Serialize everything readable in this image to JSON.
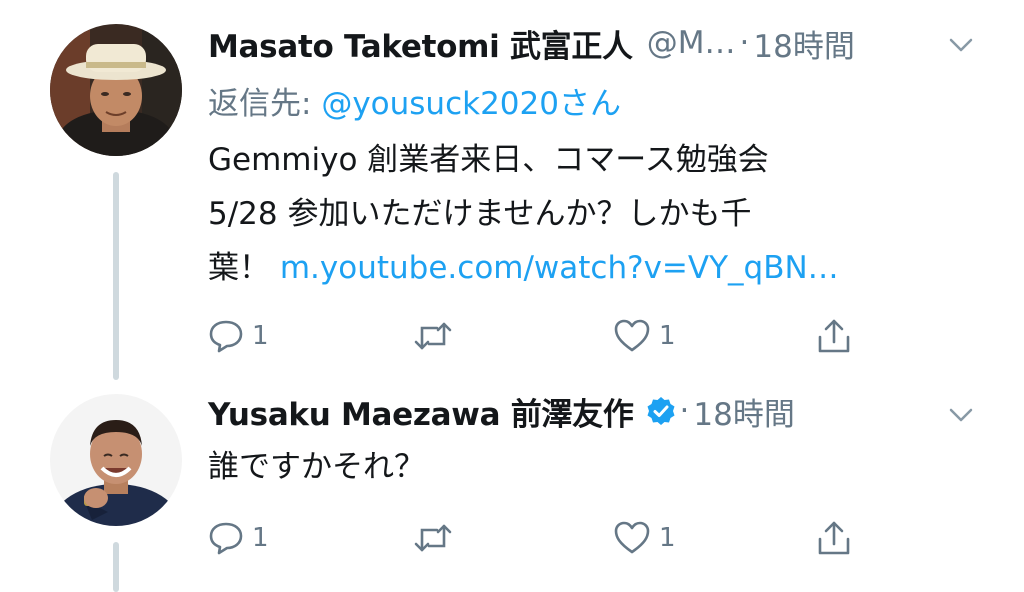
{
  "colors": {
    "text_primary": "#14171a",
    "text_secondary": "#657786",
    "link": "#1da1f2",
    "verified": "#1da1f2",
    "thread_line": "#cfd9de"
  },
  "tweets": [
    {
      "display_name": "Masato Taketomi 武富正人",
      "handle": "@M…",
      "separator": "·",
      "time": "18時間",
      "reply_to_prefix": "返信先:",
      "reply_to_mention": "@yousuck2020さん",
      "body_line1": "Gemmiyo 創業者来日、コマース勉強会",
      "body_line2": "5/28 参加いただけませんか？しかも千",
      "body_line3_text": "葉！",
      "body_line3_link": "m.youtube.com/watch?v=VY_qBN…",
      "verified": false,
      "reply_count": "1",
      "like_count": "1",
      "avatar_icon": "avatar-man-with-hat"
    },
    {
      "display_name": "Yusaku Maezawa 前澤友作",
      "separator": "·",
      "time": "18時間",
      "body_line1": "誰ですかそれ？",
      "verified": true,
      "reply_count": "1",
      "like_count": "1",
      "avatar_icon": "avatar-smiling-man"
    }
  ],
  "icons": {
    "reply": "reply-icon",
    "retweet": "retweet-icon",
    "like": "heart-icon",
    "share": "share-icon",
    "more": "chevron-down-icon",
    "verified": "verified-badge-icon"
  }
}
